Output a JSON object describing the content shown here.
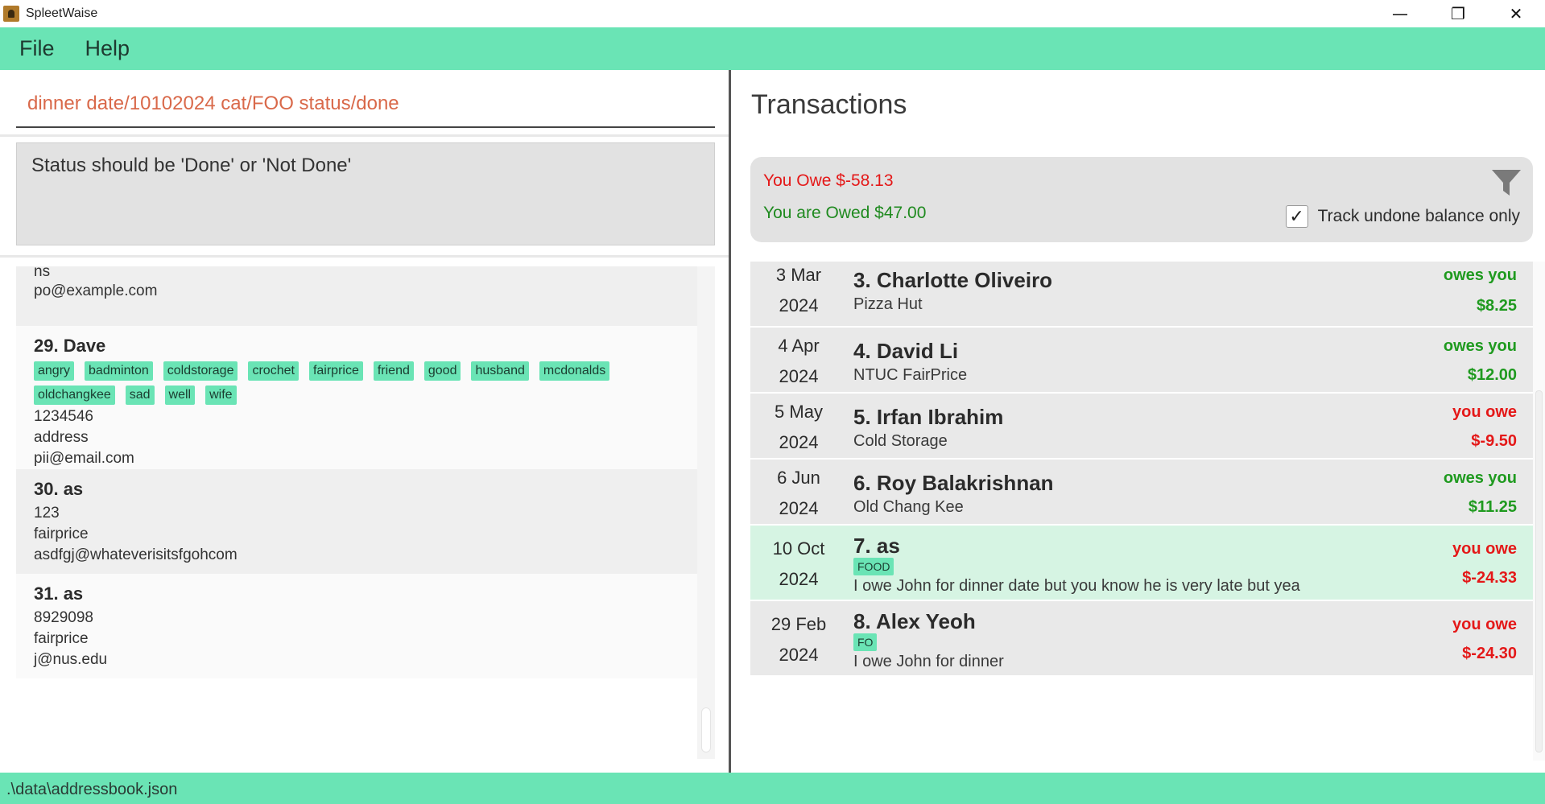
{
  "window": {
    "title": "SpleetWaise",
    "minimize_icon": "—",
    "maximize_icon": "❐",
    "close_icon": "✕"
  },
  "menu": {
    "file": "File",
    "help": "Help"
  },
  "command": {
    "value": "dinner date/10102024 cat/FOO status/done",
    "text_color": "#d9694a"
  },
  "result": {
    "message": "Status should be 'Done' or 'Not Done'"
  },
  "persons": {
    "partial": {
      "line1": "ns",
      "email": "po@example.com"
    },
    "items": [
      {
        "name": "29. Dave",
        "tags": [
          "angry",
          "badminton",
          "coldstorage",
          "crochet",
          "fairprice",
          "friend",
          "good",
          "husband",
          "mcdonalds",
          "oldchangkee",
          "sad",
          "well",
          "wife"
        ],
        "phone": "1234546",
        "address": "address",
        "email": "pii@email.com"
      },
      {
        "name": "30. as",
        "phone": "123",
        "address": "fairprice",
        "email": "asdfgj@whateverisitsfgohcom"
      },
      {
        "name": "31. as",
        "phone": "8929098",
        "address": "fairprice",
        "email": "j@nus.edu"
      }
    ]
  },
  "transactions": {
    "heading": "Transactions",
    "you_owe": "You Owe $-58.13",
    "you_are_owed": "You are Owed $47.00",
    "filter_icon": "filter-icon",
    "track_label": "Track undone balance only",
    "track_checked": "✓",
    "items": [
      {
        "date_day": "3 Mar",
        "date_year": "2024",
        "name": "3. Charlotte Oliveiro",
        "desc": "Pizza Hut",
        "kind": "owes you",
        "amount": "$8.25"
      },
      {
        "date_day": "4 Apr",
        "date_year": "2024",
        "name": "4. David Li",
        "desc": "NTUC FairPrice",
        "kind": "owes you",
        "amount": "$12.00"
      },
      {
        "date_day": "5 May",
        "date_year": "2024",
        "name": "5. Irfan Ibrahim",
        "desc": "Cold Storage",
        "kind": "you owe",
        "amount": "$-9.50"
      },
      {
        "date_day": "6 Jun",
        "date_year": "2024",
        "name": "6. Roy Balakrishnan",
        "desc": "Old Chang Kee",
        "kind": "owes you",
        "amount": "$11.25"
      },
      {
        "date_day": "10 Oct",
        "date_year": "2024",
        "name": "7. as",
        "tag": "FOOD",
        "desc": "I owe John for dinner date but you know he is very late but yea",
        "kind": "you owe",
        "amount": "$-24.33"
      },
      {
        "date_day": "29 Feb",
        "date_year": "2024",
        "name": "8. Alex Yeoh",
        "tag": "FO",
        "desc": "I owe John for dinner",
        "kind": "you owe",
        "amount": "$-24.30"
      }
    ]
  },
  "status_bar": {
    "path": ".\\data\\addressbook.json"
  },
  "colors": {
    "accent": "#6ae4b5",
    "negative": "#e41818",
    "positive": "#1f8a1f",
    "selected_row": "#d6f4e3"
  }
}
